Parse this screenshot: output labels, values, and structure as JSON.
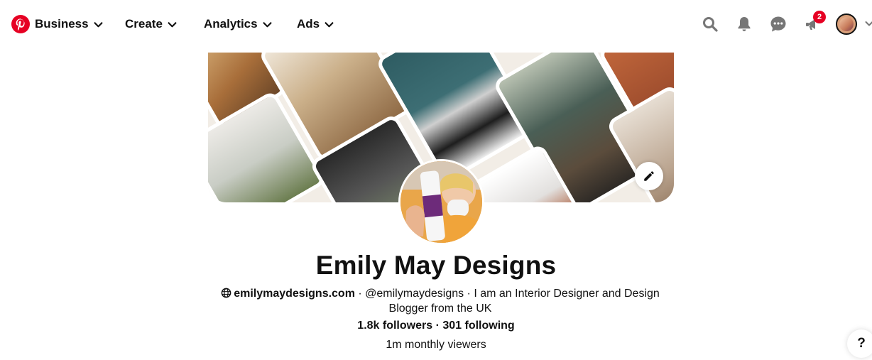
{
  "nav": {
    "logo": "pinterest-logo",
    "items": [
      {
        "label": "Business"
      },
      {
        "label": "Create"
      },
      {
        "label": "Analytics"
      },
      {
        "label": "Ads"
      }
    ],
    "icons": [
      "search-icon",
      "bell-icon",
      "chat-icon",
      "updates-icon"
    ],
    "updates_badge": "2"
  },
  "profile": {
    "name": "Emily May Designs",
    "website": "emilymaydesigns.com",
    "bio": " · @emilymaydesigns · I am an Interior Designer and Design Blogger from the UK",
    "followers": "1.8k followers",
    "separator": " · ",
    "following": "301 following",
    "monthly_viewers": "1m monthly viewers"
  },
  "help": {
    "label": "?"
  },
  "colors": {
    "brand": "#e60023",
    "text": "#111111"
  }
}
